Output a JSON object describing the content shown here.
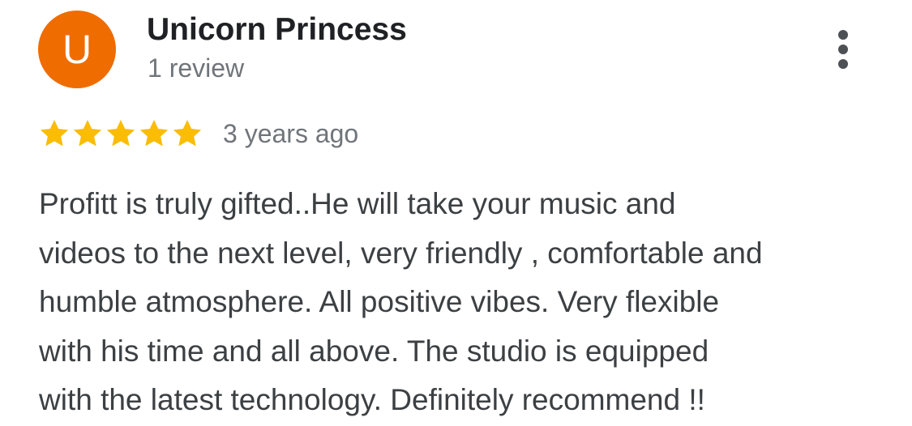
{
  "review": {
    "author": {
      "initial": "U",
      "name": "Unicorn Princess",
      "review_count": "1 review",
      "avatar_color": "#ef6c00"
    },
    "rating": 5,
    "max_rating": 5,
    "star_color": "#fbbc04",
    "time_ago": "3 years ago",
    "text_lines": [
      "Profitt is truly gifted..He will take your music and",
      "videos to the next level, very friendly , comfortable and",
      "humble atmosphere. All positive vibes. Very flexible",
      "with his time and all above. The studio is equipped",
      "with the latest technology. Definitely recommend !!"
    ]
  },
  "icons": {
    "more": "more-vert-icon",
    "star": "star-icon"
  }
}
